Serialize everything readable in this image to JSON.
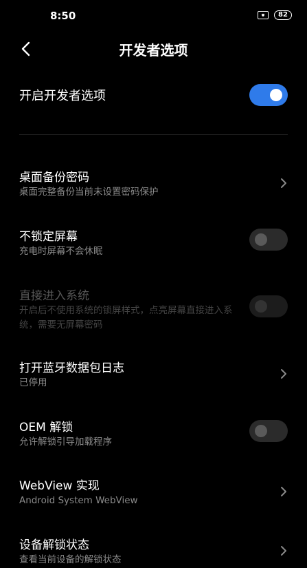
{
  "status_bar": {
    "time": "8:50",
    "battery": "82"
  },
  "header": {
    "title": "开发者选项"
  },
  "master": {
    "label": "开启开发者选项",
    "enabled": true
  },
  "settings": [
    {
      "title": "桌面备份密码",
      "subtitle": "桌面完整备份当前未设置密码保护",
      "control": "chevron"
    },
    {
      "title": "不锁定屏幕",
      "subtitle": "充电时屏幕不会休眠",
      "control": "toggle",
      "on": false
    },
    {
      "title": "直接进入系统",
      "subtitle": "开启后不使用系统的锁屏样式，点亮屏幕直接进入系统，需要无屏幕密码",
      "control": "toggle",
      "on": false,
      "disabled": true
    },
    {
      "title": "打开蓝牙数据包日志",
      "subtitle": "已停用",
      "control": "chevron"
    },
    {
      "title": "OEM 解锁",
      "subtitle": "允许解锁引导加载程序",
      "control": "toggle",
      "on": false
    },
    {
      "title": "WebView 实现",
      "subtitle": "Android System WebView",
      "control": "chevron"
    },
    {
      "title": "设备解锁状态",
      "subtitle": "查看当前设备的解锁状态",
      "control": "chevron"
    }
  ],
  "colors": {
    "background": "#000000",
    "accent": "#2f7bea",
    "subtitle": "#8a8a8a"
  }
}
